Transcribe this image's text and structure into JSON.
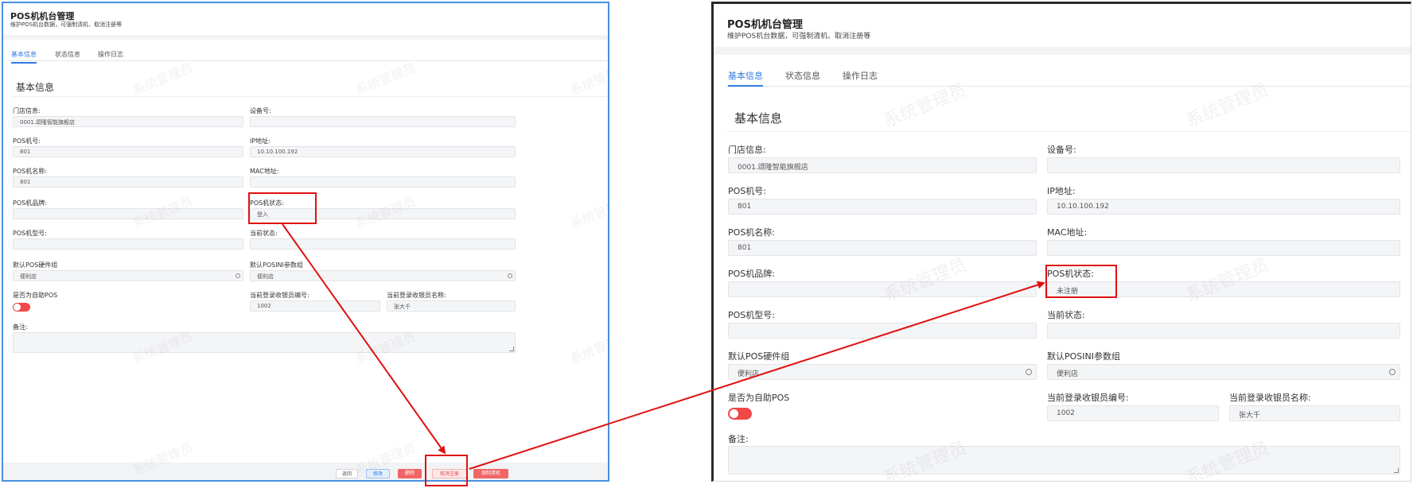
{
  "colors": {
    "accent": "#2f7be0",
    "danger": "#f04848",
    "annotation": "#e01010"
  },
  "small_panel": {
    "title": "POS机机台管理",
    "subtitle": "维护POS机台数据，可强制清机、取消注册等",
    "tabs": [
      "基本信息",
      "状态信息",
      "操作日志"
    ],
    "section_title": "基本信息",
    "fields": {
      "store_label": "门店信息:",
      "store_value": "0001.颂隆智能旗舰店",
      "device_label": "设备号:",
      "device_value": "",
      "pos_no_label": "POS机号:",
      "pos_no_value": "801",
      "ip_label": "IP地址:",
      "ip_value": "10.10.100.192",
      "pos_name_label": "POS机名称:",
      "pos_name_value": "801",
      "mac_label": "MAC地址:",
      "mac_value": "",
      "brand_label": "POS机品牌:",
      "brand_value": "",
      "status_label": "POS机状态:",
      "status_value": "登入",
      "model_label": "POS机型号:",
      "model_value": "",
      "current_status_label": "当前状态:",
      "current_status_value": "",
      "hw_group_label": "默认POS硬件组",
      "hw_group_value": "便利店",
      "ini_group_label": "默认POSINI参数组",
      "ini_group_value": "便利店",
      "self_pos_label": "是否为自助POS",
      "cashier_no_label": "当前登录收银员编号:",
      "cashier_no_value": "1002",
      "cashier_name_label": "当前登录收银员名称:",
      "cashier_name_value": "张大千",
      "remark_label": "备注:",
      "remark_value": ""
    },
    "buttons": {
      "back": "返回",
      "edit": "修改",
      "delete": "删除",
      "cancel_reg": "取消注册",
      "force_clear": "强制清机"
    }
  },
  "large_panel": {
    "title": "POS机机台管理",
    "subtitle": "维护POS机台数据，可强制清机、取消注册等",
    "tabs": [
      "基本信息",
      "状态信息",
      "操作日志"
    ],
    "section_title": "基本信息",
    "fields": {
      "store_label": "门店信息:",
      "store_value": "0001.颂隆智能旗舰店",
      "device_label": "设备号:",
      "device_value": "",
      "pos_no_label": "POS机号:",
      "pos_no_value": "801",
      "ip_label": "IP地址:",
      "ip_value": "10.10.100.192",
      "pos_name_label": "POS机名称:",
      "pos_name_value": "801",
      "mac_label": "MAC地址:",
      "mac_value": "",
      "brand_label": "POS机品牌:",
      "brand_value": "",
      "status_label": "POS机状态:",
      "status_value": "未注册",
      "model_label": "POS机型号:",
      "model_value": "",
      "current_status_label": "当前状态:",
      "current_status_value": "",
      "hw_group_label": "默认POS硬件组",
      "hw_group_value": "便利店",
      "ini_group_label": "默认POSINI参数组",
      "ini_group_value": "便利店",
      "self_pos_label": "是否为自助POS",
      "cashier_no_label": "当前登录收银员编号:",
      "cashier_no_value": "1002",
      "cashier_name_label": "当前登录收银员名称:",
      "cashier_name_value": "张大千",
      "remark_label": "备注:",
      "remark_value": ""
    }
  },
  "watermark": "系统管理员"
}
